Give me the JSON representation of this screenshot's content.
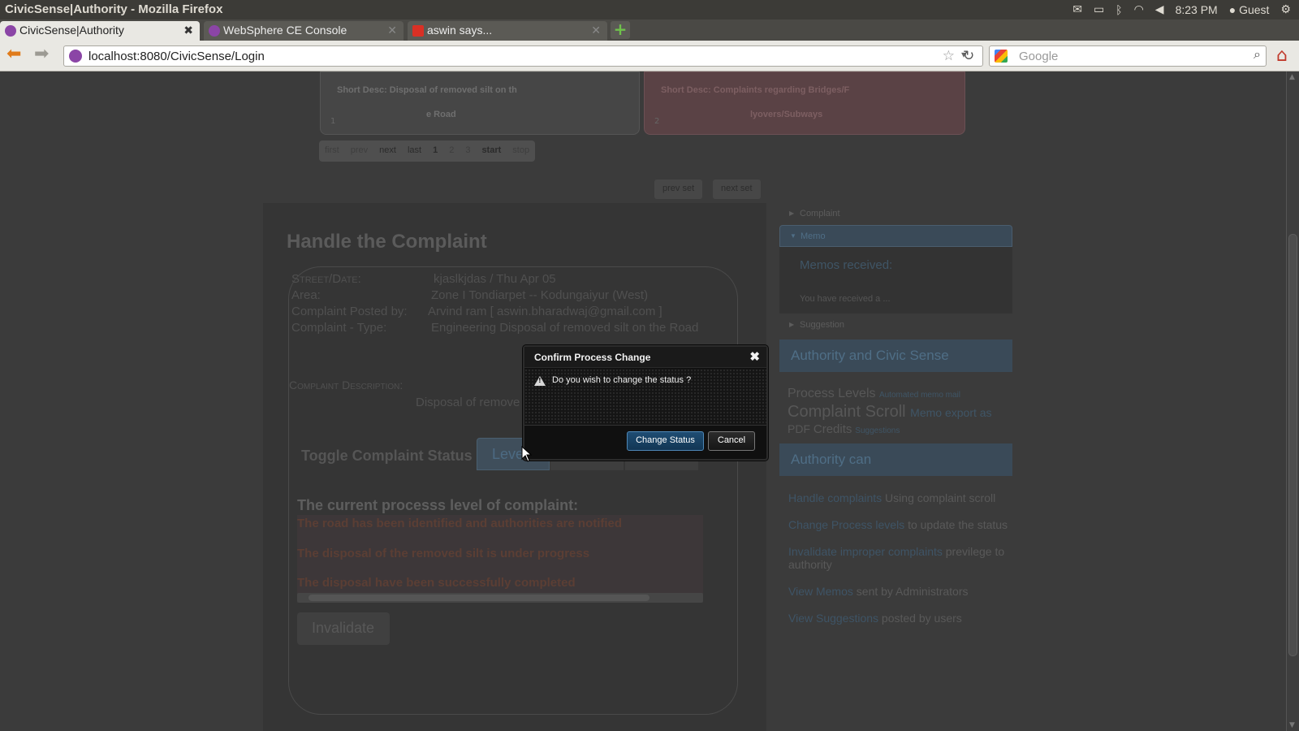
{
  "os": {
    "window_title": "CivicSense|Authority - Mozilla Firefox",
    "clock": "8:23 PM",
    "user": "Guest",
    "icons": [
      "mail-icon",
      "battery-icon",
      "bluetooth-icon",
      "wifi-icon",
      "volume-icon",
      "user-icon",
      "gear-icon"
    ]
  },
  "tabs": [
    {
      "label": "CivicSense|Authority",
      "active": true
    },
    {
      "label": "WebSphere CE Console",
      "active": false
    },
    {
      "label": "aswin says...",
      "active": false
    }
  ],
  "nav": {
    "url": "localhost:8080/CivicSense/Login",
    "search_placeholder": "Google"
  },
  "scroll_cards": [
    {
      "desc_line1": "Short Desc: Disposal of removed silt on th",
      "desc_line2": "e Road",
      "num": "1"
    },
    {
      "desc_line1": "Short Desc: Complaints regarding Bridges/F",
      "desc_line2": "lyovers/Subways",
      "num": "2"
    }
  ],
  "pager": {
    "first": "first",
    "prev": "prev",
    "next": "next",
    "last": "last",
    "p1": "1",
    "p2": "2",
    "p3": "3",
    "start": "start",
    "stop": "stop"
  },
  "sets": {
    "prev": "prev set",
    "next": "next set"
  },
  "complaint": {
    "title": "Handle the Complaint",
    "street_label": "Street/Date:",
    "street_value": "kjaslkjdas / Thu Apr 05",
    "area_label": "Area:",
    "area_value": "Zone I Tondiarpet -- Kodungaiyur (West)",
    "posted_label": "Complaint Posted by:",
    "posted_value": "Arvind ram [ aswin.bharadwaj@gmail.com ]",
    "type_label": "Complaint - Type:",
    "type_value": "Engineering Disposal of removed silt on the Road",
    "desc_label": "Complaint Description:",
    "desc_value": "Disposal of remove"
  },
  "toggle": {
    "label": "Toggle Complaint Status",
    "levels_tab": "Leve"
  },
  "levels": {
    "heading": "The current processs level of complaint:",
    "items": [
      "The road has been identified and authorities are notified",
      "The disposal of the removed silt is under progress",
      "The disposal have been successfully completed"
    ]
  },
  "invalidate_label": "Invalidate",
  "sidebar": {
    "complaint": "Complaint",
    "memo": "Memo",
    "memos_received": "Memos received:",
    "memo_preview": "You have received a ...",
    "suggestion": "Suggestion",
    "band1": "Authority and Civic Sense",
    "cloud": {
      "process_levels": "Process Levels",
      "automated_memo": "Automated memo mail",
      "complaint_scroll": "Complaint Scroll",
      "memo_export": "Memo export as",
      "pdf": "PDF",
      "credits": "Credits",
      "suggestions": "Suggestions"
    },
    "band2": "Authority can",
    "items": [
      {
        "link": "Handle complaints",
        "text": " Using complaint scroll"
      },
      {
        "link": "Change Process levels",
        "text": " to update the status"
      },
      {
        "link": "Invalidate improper complaints",
        "text": " previlege to authority"
      },
      {
        "link": "View Memos",
        "text": " sent by Administrators"
      },
      {
        "link": "View Suggestions",
        "text": " posted by users"
      }
    ]
  },
  "dialog": {
    "title": "Confirm Process Change",
    "message": "Do you wish to change the status ?",
    "confirm": "Change Status",
    "cancel": "Cancel"
  },
  "colors": {
    "dialog_primary": "#1f4d73",
    "overlay": "#3b3b3b",
    "accent_band": "#3a4a58"
  }
}
